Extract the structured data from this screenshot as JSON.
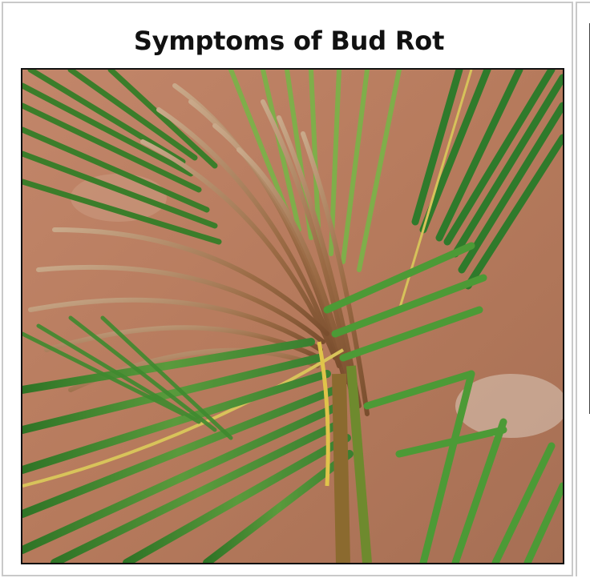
{
  "slide": {
    "title": "Symptoms of Bud Rot"
  },
  "photo": {
    "subject": "coconut-palm-bud-rot",
    "colors": {
      "soil": "#b97d5e",
      "green_leaf": "#3f8a2f",
      "dead_leaf": "#9a6a44"
    }
  }
}
